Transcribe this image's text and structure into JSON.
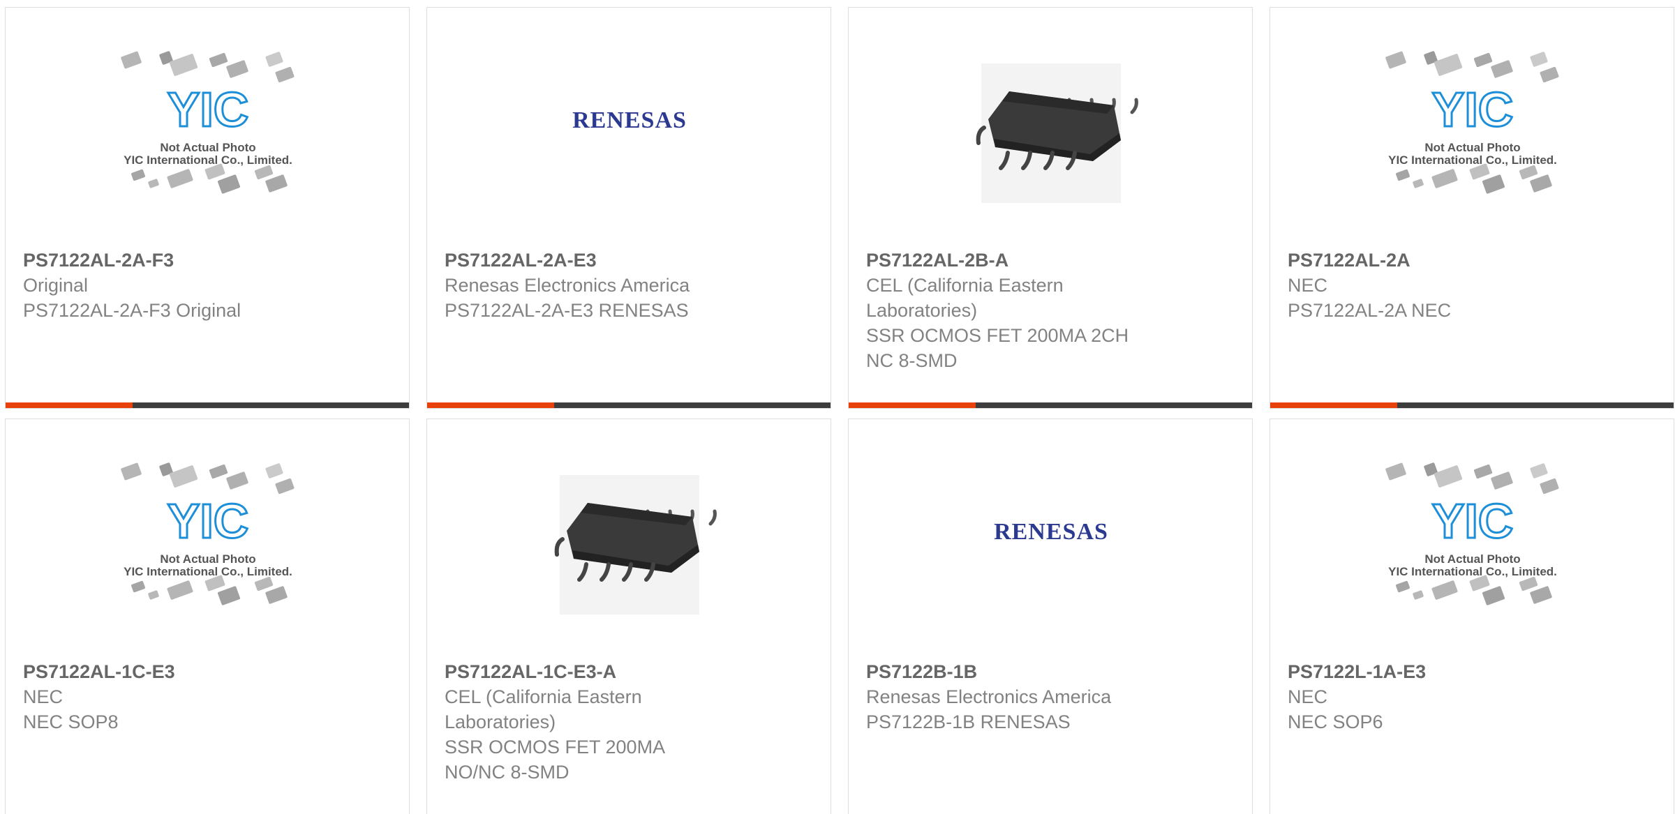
{
  "products": [
    {
      "part": "PS7122AL-2A-F3",
      "image": "yic-placeholder-icon",
      "image_text": [
        "Not Actual Photo",
        "YIC International Co., Limited."
      ],
      "logo_text": "YIC",
      "lines": [
        "Original",
        "PS7122AL-2A-F3 Original"
      ]
    },
    {
      "part": "PS7122AL-2A-E3",
      "image": "renesas-logo-icon",
      "logo_text": "RENESAS",
      "lines": [
        "Renesas Electronics America",
        "PS7122AL-2A-E3 RENESAS"
      ]
    },
    {
      "part": "PS7122AL-2B-A",
      "image": "smd-chip-icon",
      "lines": [
        "CEL (California Eastern",
        "Laboratories)",
        "SSR OCMOS FET 200MA 2CH",
        "NC 8-SMD"
      ]
    },
    {
      "part": "PS7122AL-2A",
      "image": "yic-placeholder-icon",
      "image_text": [
        "Not Actual Photo",
        "YIC International Co., Limited."
      ],
      "logo_text": "YIC",
      "lines": [
        "NEC",
        "PS7122AL-2A NEC"
      ]
    },
    {
      "part": "PS7122AL-1C-E3",
      "image": "yic-placeholder-icon",
      "image_text": [
        "Not Actual Photo",
        "YIC International Co., Limited."
      ],
      "logo_text": "YIC",
      "lines": [
        "NEC",
        "NEC SOP8"
      ]
    },
    {
      "part": "PS7122AL-1C-E3-A",
      "image": "smd-chip-icon",
      "lines": [
        "CEL (California Eastern",
        "Laboratories)",
        "SSR OCMOS FET 200MA",
        "NO/NC 8-SMD"
      ]
    },
    {
      "part": "PS7122B-1B",
      "image": "renesas-logo-icon",
      "logo_text": "RENESAS",
      "lines": [
        "Renesas Electronics America",
        "PS7122B-1B RENESAS"
      ]
    },
    {
      "part": "PS7122L-1A-E3",
      "image": "yic-placeholder-icon",
      "image_text": [
        "Not Actual Photo",
        "YIC International Co., Limited."
      ],
      "logo_text": "YIC",
      "lines": [
        "NEC",
        "NEC SOP6"
      ]
    }
  ],
  "colors": {
    "accent": "#e8410c",
    "bar": "#3d3d3d",
    "part_text": "#666666",
    "desc_text": "#828282",
    "renesas_blue": "#2b3990",
    "yic_blue": "#1c8fd8",
    "chip": "#3a3a3a"
  }
}
